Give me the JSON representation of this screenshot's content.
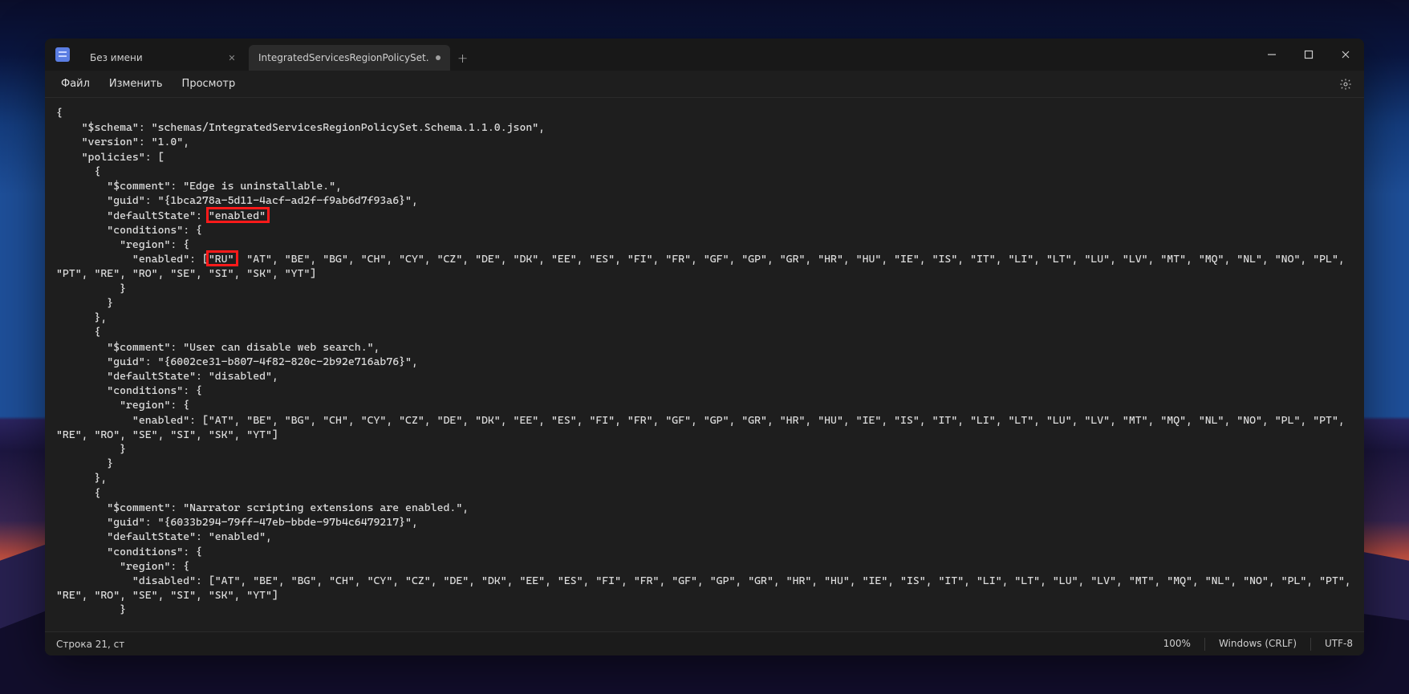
{
  "colors": {
    "accent_red": "#ff1a1a",
    "window_bg": "#1e1e1e",
    "titlebar_bg": "#181818"
  },
  "tabs": {
    "items": [
      {
        "label": "Без имени",
        "modified": false,
        "active": false
      },
      {
        "label": "IntegratedServicesRegionPolicySet.",
        "modified": true,
        "active": true
      }
    ]
  },
  "menubar": {
    "file": "Файл",
    "edit": "Изменить",
    "view": "Просмотр"
  },
  "window_controls": {
    "minimize": "minimize",
    "maximize": "maximize",
    "close": "close"
  },
  "highlights": [
    {
      "text": "\"enabled\"",
      "context": "defaultState"
    },
    {
      "text": "\"RU\"",
      "context": "policies[0].conditions.region.enabled[0]"
    }
  ],
  "statusbar": {
    "position_label": "Строка 21, ст",
    "zoom": "100%",
    "line_endings": "Windows (CRLF)",
    "encoding": "UTF-8"
  },
  "editor": {
    "text": "{\n    \"$schema\": \"schemas/IntegratedServicesRegionPolicySet.Schema.1.1.0.json\",\n    \"version\": \"1.0\",\n    \"policies\": [\n      {\n        \"$comment\": \"Edge is uninstallable.\",\n        \"guid\": \"{1bca278a-5d11-4acf-ad2f-f9ab6d7f93a6}\",\n        \"defaultState\": \"enabled\",\n        \"conditions\": {\n          \"region\": {\n            \"enabled\": [\"RU\", \"AT\", \"BE\", \"BG\", \"CH\", \"CY\", \"CZ\", \"DE\", \"DK\", \"EE\", \"ES\", \"FI\", \"FR\", \"GF\", \"GP\", \"GR\", \"HR\", \"HU\", \"IE\", \"IS\", \"IT\", \"LI\", \"LT\", \"LU\", \"LV\", \"MT\", \"MQ\", \"NL\", \"NO\", \"PL\", \"PT\", \"RE\", \"RO\", \"SE\", \"SI\", \"SK\", \"YT\"]\n          }\n        }\n      },\n      {\n        \"$comment\": \"User can disable web search.\",\n        \"guid\": \"{6002ce31-b807-4f82-820c-2b92e716ab76}\",\n        \"defaultState\": \"disabled\",\n        \"conditions\": {\n          \"region\": {\n            \"enabled\": [\"AT\", \"BE\", \"BG\", \"CH\", \"CY\", \"CZ\", \"DE\", \"DK\", \"EE\", \"ES\", \"FI\", \"FR\", \"GF\", \"GP\", \"GR\", \"HR\", \"HU\", \"IE\", \"IS\", \"IT\", \"LI\", \"LT\", \"LU\", \"LV\", \"MT\", \"MQ\", \"NL\", \"NO\", \"PL\", \"PT\", \"RE\", \"RO\", \"SE\", \"SI\", \"SK\", \"YT\"]\n          }\n        }\n      },\n      {\n        \"$comment\": \"Narrator scripting extensions are enabled.\",\n        \"guid\": \"{6033b294-79ff-47eb-bbde-97b4c6479217}\",\n        \"defaultState\": \"enabled\",\n        \"conditions\": {\n          \"region\": {\n            \"disabled\": [\"AT\", \"BE\", \"BG\", \"CH\", \"CY\", \"CZ\", \"DE\", \"DK\", \"EE\", \"ES\", \"FI\", \"FR\", \"GF\", \"GP\", \"GR\", \"HR\", \"HU\", \"IE\", \"IS\", \"IT\", \"LI\", \"LT\", \"LU\", \"LV\", \"MT\", \"MQ\", \"NL\", \"NO\", \"PL\", \"PT\", \"RE\", \"RO\", \"SE\", \"SI\", \"SK\", \"YT\"]\n          }"
  },
  "policy_file": {
    "$schema": "schemas/IntegratedServicesRegionPolicySet.Schema.1.1.0.json",
    "version": "1.0",
    "policies": [
      {
        "$comment": "Edge is uninstallable.",
        "guid": "{1bca278a-5d11-4acf-ad2f-f9ab6d7f93a6}",
        "defaultState": "enabled",
        "conditions": {
          "region": {
            "enabled": [
              "RU",
              "AT",
              "BE",
              "BG",
              "CH",
              "CY",
              "CZ",
              "DE",
              "DK",
              "EE",
              "ES",
              "FI",
              "FR",
              "GF",
              "GP",
              "GR",
              "HR",
              "HU",
              "IE",
              "IS",
              "IT",
              "LI",
              "LT",
              "LU",
              "LV",
              "MT",
              "MQ",
              "NL",
              "NO",
              "PL",
              "PT",
              "RE",
              "RO",
              "SE",
              "SI",
              "SK",
              "YT"
            ]
          }
        }
      },
      {
        "$comment": "User can disable web search.",
        "guid": "{6002ce31-b807-4f82-820c-2b92e716ab76}",
        "defaultState": "disabled",
        "conditions": {
          "region": {
            "enabled": [
              "AT",
              "BE",
              "BG",
              "CH",
              "CY",
              "CZ",
              "DE",
              "DK",
              "EE",
              "ES",
              "FI",
              "FR",
              "GF",
              "GP",
              "GR",
              "HR",
              "HU",
              "IE",
              "IS",
              "IT",
              "LI",
              "LT",
              "LU",
              "LV",
              "MT",
              "MQ",
              "NL",
              "NO",
              "PL",
              "PT",
              "RE",
              "RO",
              "SE",
              "SI",
              "SK",
              "YT"
            ]
          }
        }
      },
      {
        "$comment": "Narrator scripting extensions are enabled.",
        "guid": "{6033b294-79ff-47eb-bbde-97b4c6479217}",
        "defaultState": "enabled",
        "conditions": {
          "region": {
            "disabled": [
              "AT",
              "BE",
              "BG",
              "CH",
              "CY",
              "CZ",
              "DE",
              "DK",
              "EE",
              "ES",
              "FI",
              "FR",
              "GF",
              "GP",
              "GR",
              "HR",
              "HU",
              "IE",
              "IS",
              "IT",
              "LI",
              "LT",
              "LU",
              "LV",
              "MT",
              "MQ",
              "NL",
              "NO",
              "PL",
              "PT",
              "RE",
              "RO",
              "SE",
              "SI",
              "SK",
              "YT"
            ]
          }
        }
      }
    ]
  }
}
